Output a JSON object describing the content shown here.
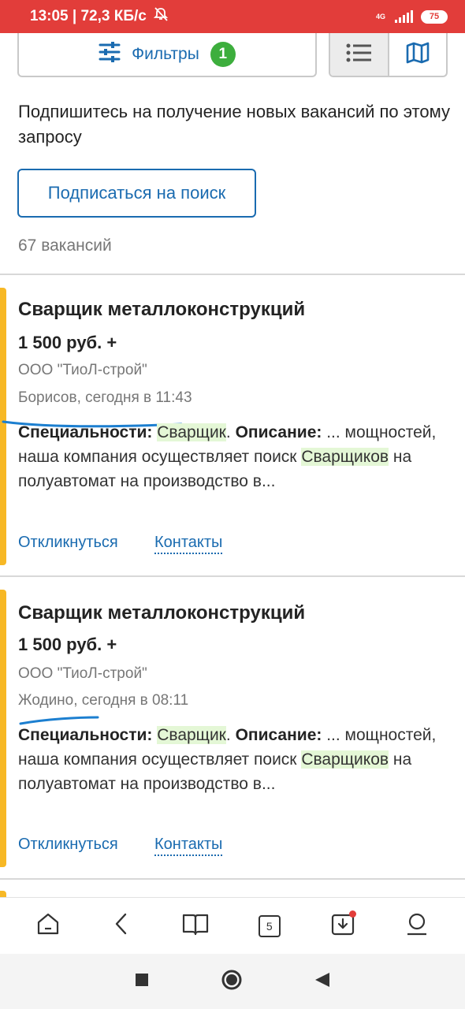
{
  "status_bar": {
    "time_speed": "13:05 | 72,3 КБ/с",
    "network": "4G",
    "battery": "75"
  },
  "toolbar": {
    "filters_label": "Фильтры",
    "filters_badge": "1"
  },
  "subscribe": {
    "text": "Подпишитесь на получение новых вакансий по этому запросу",
    "button_label": "Подписаться на поиск"
  },
  "results": {
    "count": "67 вакансий"
  },
  "vacancies": [
    {
      "title": "Сварщик металлоконструкций",
      "salary": "1 500 руб. +",
      "company": "ООО \"ТиоЛ-строй\"",
      "place_time": "Борисов, сегодня в 11:43",
      "desc_label_spec": "Специальности:",
      "desc_spec": "Сварщик",
      "desc_dot": ".",
      "desc_label_desc": "Описание:",
      "desc_text_1": "... мощностей, наша компания осуществляет поиск",
      "desc_hl": "Сварщиков",
      "desc_text_2": "на полуавтомат на производство в...",
      "respond": "Откликнуться",
      "contacts": "Контакты"
    },
    {
      "title": "Сварщик металлоконструкций",
      "salary": "1 500 руб. +",
      "company": "ООО \"ТиоЛ-строй\"",
      "place_time": "Жодино, сегодня в 08:11",
      "desc_label_spec": "Специальности:",
      "desc_spec": "Сварщик",
      "desc_dot": ".",
      "desc_label_desc": "Описание:",
      "desc_text_1": "... мощностей, наша компания осуществляет поиск",
      "desc_hl": "Сварщиков",
      "desc_text_2": "на полуавтомат на производство в...",
      "respond": "Откликнуться",
      "contacts": "Контакты"
    }
  ],
  "bottom_nav": {
    "tabs_count": "5"
  },
  "colors": {
    "status_bar": "#e23d3a",
    "link": "#1a6bb0",
    "badge": "#3dae3d",
    "accent": "#f7b825",
    "highlight": "#e4f7d6",
    "scribble": "#1c7fd0"
  },
  "icons": [
    "mute-icon",
    "signal-icon",
    "battery-icon",
    "sliders-icon",
    "list-icon",
    "map-icon",
    "home-icon",
    "back-icon",
    "book-icon",
    "tabs-icon",
    "download-icon",
    "profile-icon",
    "square-icon",
    "circle-icon",
    "triangle-icon"
  ]
}
